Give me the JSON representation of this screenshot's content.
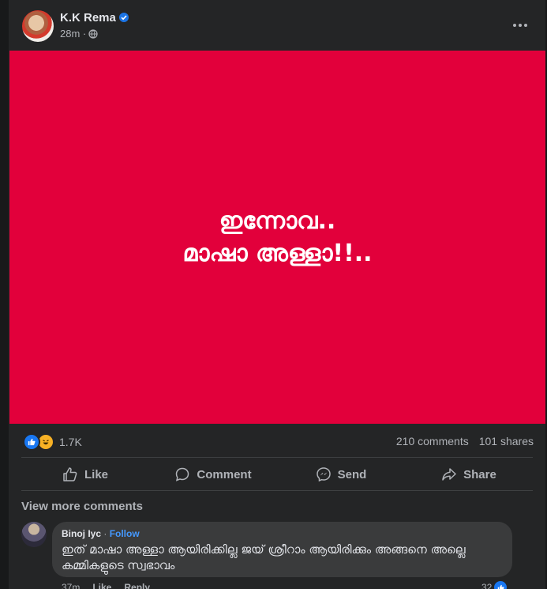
{
  "post": {
    "author": "K.K Rema",
    "time": "28m ·",
    "image_line1": "ഇന്നോവ..",
    "image_line2": "മാഷാ അള്ളാ!!..",
    "image_bg": "#e2003b"
  },
  "stats": {
    "reaction_count": "1.7K",
    "comments": "210 comments",
    "shares": "101 shares"
  },
  "actions": {
    "like": "Like",
    "comment": "Comment",
    "send": "Send",
    "share": "Share"
  },
  "comments_section": {
    "view_more": "View more comments",
    "items": [
      {
        "name": "Binoj Iyc",
        "sep": " · ",
        "follow": "Follow",
        "text": "ഇത് മാഷാ അള്ളാ ആയിരിക്കില്ല ജയ് ശ്രീറാം ആയിരിക്കും അങ്ങനെ അല്ലെ കമ്മികളുടെ സ്വഭാവം",
        "time": "37m",
        "like_label": "Like",
        "reply_label": "Reply",
        "likes": "32"
      }
    ]
  },
  "icons": {
    "verified": "verified-badge-icon",
    "privacy": "globe-icon",
    "menu": "more-options-icon",
    "reaction_like": "thumbs-up-icon",
    "reaction_haha": "haha-icon"
  },
  "colors": {
    "accent": "#1877f2",
    "follow": "#4599ff",
    "card": "#242526"
  }
}
